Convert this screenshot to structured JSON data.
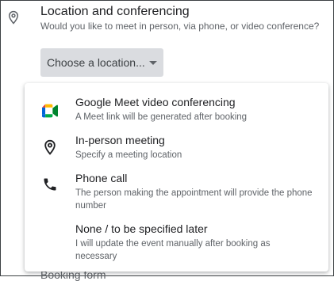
{
  "section": {
    "title": "Location and conferencing",
    "subtitle": "Would you like to meet in person, via phone, or video conference?"
  },
  "select": {
    "label": "Choose a location...",
    "icon": "chevron-down-icon"
  },
  "menu": {
    "options": [
      {
        "title": "Google Meet video conferencing",
        "description": "A Meet link will be generated after booking",
        "icon": "google-meet-icon"
      },
      {
        "title": "In-person meeting",
        "description": "Specify a meeting location",
        "icon": "location-pin-icon"
      },
      {
        "title": "Phone call",
        "description": "The person making the appointment will provide the phone number",
        "icon": "phone-icon"
      },
      {
        "title": "None / to be specified later",
        "description": "I will update the event manually after booking as necessary",
        "icon": ""
      }
    ]
  },
  "colors": {
    "meet_green": "#00832d",
    "meet_blue": "#0066da",
    "meet_red": "#e94235",
    "meet_yellow": "#ffba00",
    "meet_dark_green": "#00ac47",
    "select_bg": "#dadce0"
  }
}
